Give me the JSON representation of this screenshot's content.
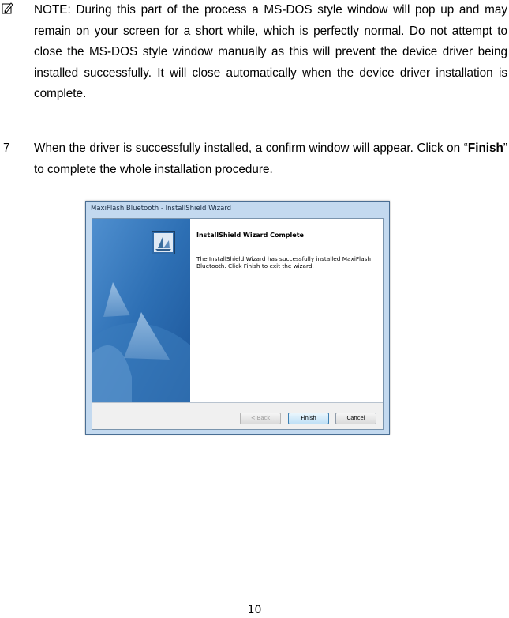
{
  "note": {
    "text": "NOTE: During this part of the process a MS-DOS style window will pop up and may remain on your screen for a short while, which is perfectly normal. Do not attempt to close the MS-DOS style window manually as this will prevent the device driver being installed successfully. It will close automatically when the device driver installation is complete.",
    "icon": "pencil-note-icon"
  },
  "step": {
    "number": "7",
    "text_before": "When the driver is successfully installed, a confirm window will appear. Click on “",
    "bold": "Finish",
    "text_after": "” to complete the whole installation procedure."
  },
  "window": {
    "title": "MaxiFlash Bluetooth - InstallShield Wizard",
    "heading": "InstallShield Wizard Complete",
    "body": "The InstallShield Wizard has successfully installed MaxiFlash Bluetooth.  Click Finish to exit the wizard.",
    "buttons": {
      "back": "< Back",
      "finish": "Finish",
      "cancel": "Cancel"
    }
  },
  "page_number": "10"
}
